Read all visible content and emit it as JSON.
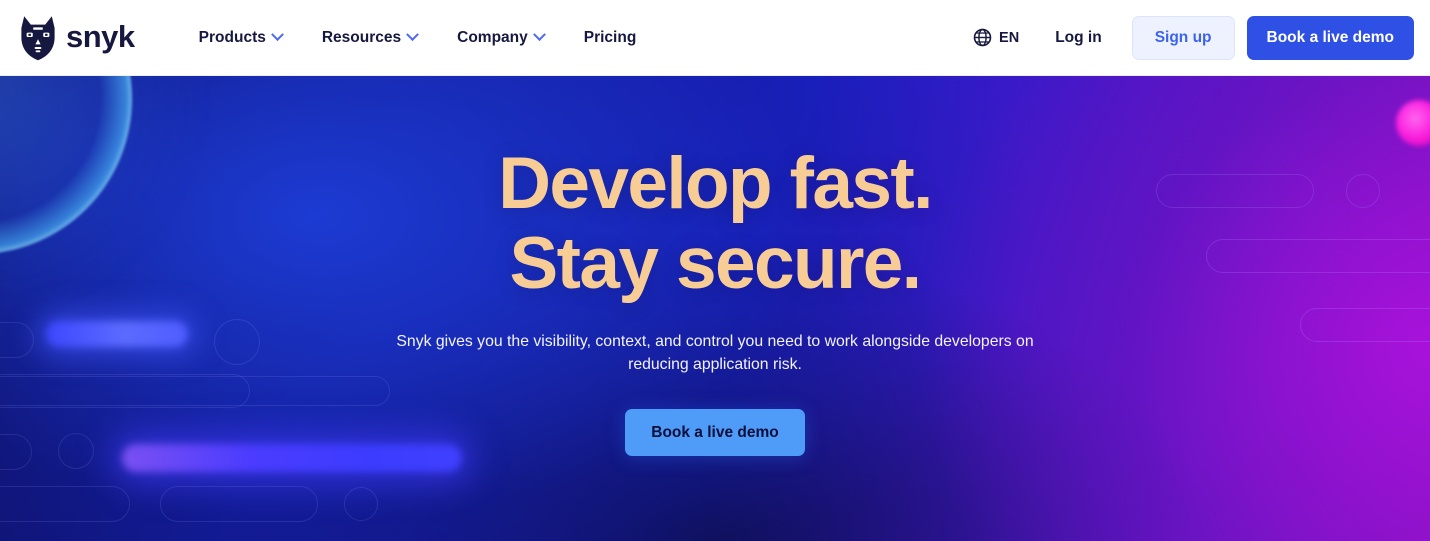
{
  "brand": {
    "name": "snyk",
    "logo_icon": "snyk-doberman-logo"
  },
  "nav": {
    "items": [
      {
        "label": "Products",
        "has_dropdown": true,
        "icon": "chevron-down-icon"
      },
      {
        "label": "Resources",
        "has_dropdown": true,
        "icon": "chevron-down-icon"
      },
      {
        "label": "Company",
        "has_dropdown": true,
        "icon": "chevron-down-icon"
      },
      {
        "label": "Pricing",
        "has_dropdown": false,
        "icon": ""
      }
    ],
    "language": {
      "code": "EN",
      "icon": "globe-icon"
    },
    "login_label": "Log in",
    "signup_label": "Sign up",
    "demo_label": "Book a live demo"
  },
  "hero": {
    "headline_line1": "Develop fast.",
    "headline_line2": "Stay secure.",
    "subhead": "Snyk gives you the visibility, context, and control you need to work alongside developers on reducing application risk.",
    "cta_label": "Book a live demo"
  },
  "colors": {
    "brand_navy": "#16183F",
    "accent_blue": "#2E50E4",
    "link_blue": "#3B63F0",
    "signup_bg": "#EEF2FE",
    "headline_peach": "#F7CD95",
    "hero_cta_blue": "#4F9BF8",
    "hero_gradient_start": "#0D1060",
    "hero_gradient_mid": "#1B1FC8",
    "hero_gradient_end": "#9A11C8",
    "accent_magenta": "#FB22DF",
    "accent_cyan": "#B4F0FF"
  }
}
